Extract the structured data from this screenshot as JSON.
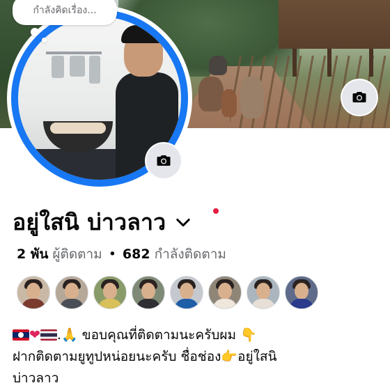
{
  "bubble": {
    "text": "กำลังคิดเรื่อง..."
  },
  "profile": {
    "name": "อยู่ใสนิ บ่าวลาว",
    "followers_count": "2 พัน",
    "followers_label": "ผู้ติดตาม",
    "separator": "•",
    "following_count": "682",
    "following_label": "กำลังติดตาม"
  },
  "bio": {
    "line1_prefix": ".🙏 ขอบคุณที่ติดตามนะครับผม 👇",
    "line2": " ฝากติดตามยูทูปหน่อยนะครับ ชื่อช่อง👉อยู่ใสนิ",
    "line3": "บ่าวลาว"
  },
  "icons": {
    "cover_camera": "camera-icon",
    "avatar_camera": "camera-icon",
    "name_dropdown": "chevron-down-icon",
    "notification": "red-dot"
  },
  "colors": {
    "accent_blue": "#1877f2",
    "secondary_text": "#65676b",
    "notification_red": "#e41e3f",
    "button_gray": "#e4e6eb"
  },
  "followers_avatars": [
    {
      "shirt": "#7a3b2e",
      "bg": "#c9b8a5"
    },
    {
      "shirt": "#4a4f57",
      "bg": "#b6a898"
    },
    {
      "shirt": "#d8c05a",
      "bg": "#8a9b6a"
    },
    {
      "shirt": "#2e2e33",
      "bg": "#7f8a76"
    },
    {
      "shirt": "#1f5fa8",
      "bg": "#c5c9cf"
    },
    {
      "shirt": "#efe6dc",
      "bg": "#8f8678"
    },
    {
      "shirt": "#e7ded6",
      "bg": "#aab5bd"
    },
    {
      "shirt": "#2a3b8c",
      "bg": "#5e6b8a"
    }
  ]
}
